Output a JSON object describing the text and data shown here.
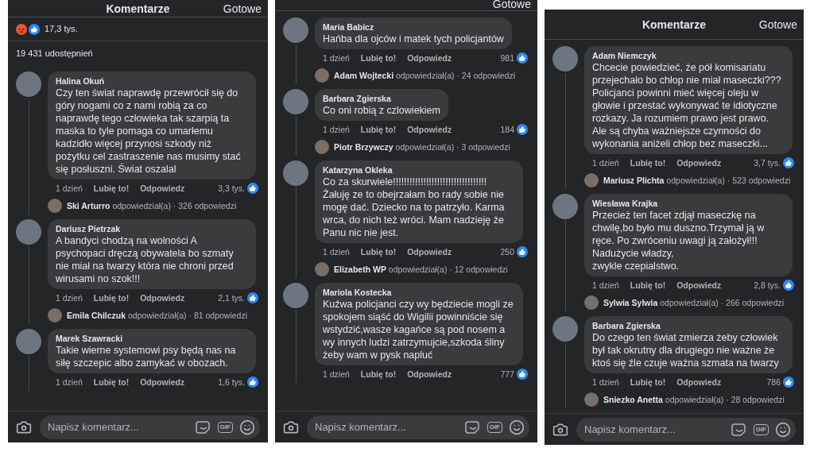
{
  "panels": [
    {
      "header": {
        "title": "Komentarze",
        "done": "Gotowe"
      },
      "reactions": {
        "count": "17,3 tys."
      },
      "shares": "19 431 udostępnień",
      "comments": [
        {
          "author": "Halina Okuń",
          "text": "Czy ten świat naprawdę przewrócił się do góry nogami co z nami robią za co naprawdę tego człowieka tak szarpią  ta maska to tyle pomaga co umarłemu kadzidło  więcej przynosi  szkody niż pożytku  cel  zastraszenie nas musimy stać się posłuszni. Świat oszalal",
          "time": "1 dzień",
          "like": "Lubię to!",
          "reply": "Odpowiedz",
          "likes": "3,3 tys.",
          "replies": "**Ski Arturro** odpowiedział(a) · 326 odpowiedzi"
        },
        {
          "author": "Dariusz Pietrzak",
          "text": "A bandyci chodzą na wolności A psychopaci dręczą obywatela bo szmaty nie miał na twarzy która nie chroni przed wirusami no szok!!!",
          "time": "1 dzień",
          "like": "Lubię to!",
          "reply": "Odpowiedz",
          "likes": "2,1 tys.",
          "replies": "**Emila Chilczuk** odpowiedział(a) · 81 odpowiedzi"
        },
        {
          "author": "Marek Szawracki",
          "text": "Takie wierne systemowi psy będą nas na siłę szczepic albo zamykać w obozach.",
          "time": "1 dzień",
          "like": "Lubię to!",
          "reply": "Odpowiedz",
          "likes": "1,6 tys."
        }
      ],
      "composer": {
        "placeholder": "Napisz komentarz...",
        "gif": "GIF"
      }
    },
    {
      "header": {
        "done": "Gotowe"
      },
      "comments": [
        {
          "author": "Maria Babicz",
          "text": "Hańba dla ojców i matek tych policjantów",
          "time": "1 dzień",
          "like": "Lubię to!",
          "reply": "Odpowiedz",
          "likes": "981",
          "replies": "**Adam Wojtecki** odpowiedział(a) · 24 odpowiedzi"
        },
        {
          "author": "Barbara Zgierska",
          "text": "Co oni robią z czlowiekiem",
          "time": "1 dzień",
          "like": "Lubię to!",
          "reply": "Odpowiedz",
          "likes": "184",
          "replies": "**Piotr Brzywczy** odpowiedział(a) · 3 odpowiedzi"
        },
        {
          "author": "Katarzyna Okleka",
          "text": "Co za skurwiele!!!!!!!!!!!!!!!!!!!!!!!!!!!!!!!!!!\nŻałuję ze to obejrzałam bo rady sobie nie mogę dać. Dziecko na to patrzyło.  Karma wrca, do nich też wróci.  Mam nadzieję że Panu nic nie jest.",
          "time": "1 dzień",
          "like": "Lubię to!",
          "reply": "Odpowiedz",
          "likes": "250",
          "replies": "**Elizabeth WP** odpowiedział(a) · 12 odpowiedzi"
        },
        {
          "author": "Mariola Kostecka",
          "text": "Kuźwa policjanci czy wy będziecie mogli ze spokojem siąść do Wigilii powinniście się wstydzić,wasze kagańce są pod nosem a wy innych ludzi zatrzymujcie,szkoda śliny żeby wam w pysk napluć",
          "time": "1 dzień",
          "like": "Lubię to!",
          "reply": "Odpowiedz",
          "likes": "777"
        }
      ],
      "composer": {
        "placeholder": "Napisz komentarz...",
        "gif": "GIF"
      }
    },
    {
      "header": {
        "title": "Komentarze",
        "done": "Gotowe"
      },
      "comments": [
        {
          "author": "Adam Niemczyk",
          "text": "Chcecie powiedzieć, że pół komisariatu przejechało bo chłop nie miał maseczki??? Policjanci powinni mieć więcej oleju w głowie i przestać wykonywać te idiotyczne rozkazy. Ja rozumiem prawo jest prawo. Ale są chyba ważniejsze czynności do wykonania aniżeli chłop bez maseczki...",
          "time": "1 dzień",
          "like": "Lubię to!",
          "reply": "Odpowiedz",
          "likes": "3,7 tys.",
          "replies": "**Mariusz Plichta** odpowiedział(a) · 523 odpowiedzi"
        },
        {
          "author": "Wiesława Krajka",
          "text": "Przecież ten facet zdjął maseczkę na chwilę,bo było mu duszno.Trzymał ją w ręce. Po zwróceniu uwagi ją założył!!!\nNadużycie władzy,\nzwykle czepialstwo.",
          "time": "1 dzień",
          "like": "Lubię to!",
          "reply": "Odpowiedz",
          "likes": "2,8 tys.",
          "replies": "**Sylwia Sylwia** odpowiedział(a) · 266 odpowiedzi"
        },
        {
          "author": "Barbara Zgierska",
          "text": "Do czego ten świat zmierza żeby człowiek był tak okrutny dla drugiego nie ważne że ktoś się źle czuje ważna szmata na twarzy",
          "time": "1 dzień",
          "like": "Lubię to!",
          "reply": "Odpowiedz",
          "likes": "786",
          "replies": "**Sniezko Anetta** odpowiedział(a) · 28 odpowiedzi"
        }
      ],
      "composer": {
        "placeholder": "Napisz komentarz...",
        "gif": "GIF"
      }
    }
  ]
}
